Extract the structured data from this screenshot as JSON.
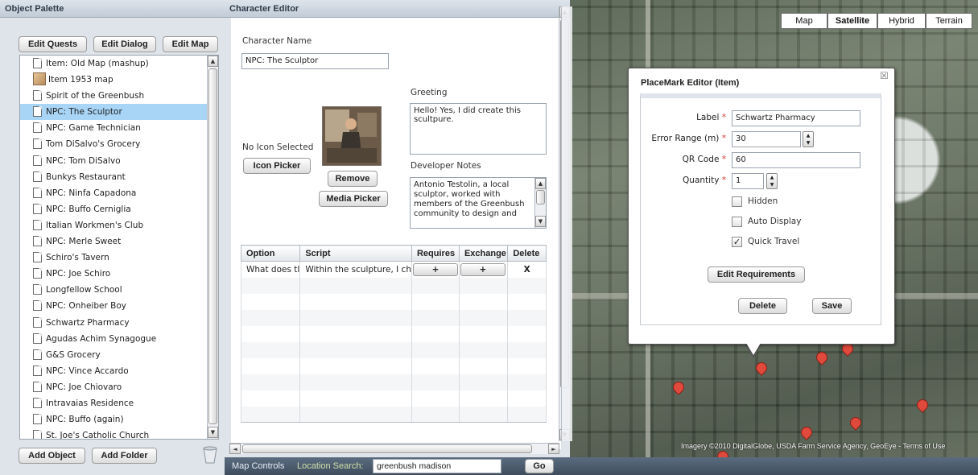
{
  "palette": {
    "title": "Object Palette",
    "buttons": {
      "edit_quests": "Edit Quests",
      "edit_dialog": "Edit Dialog",
      "edit_map": "Edit Map",
      "add_object": "Add Object",
      "add_folder": "Add Folder"
    },
    "items": [
      "Item: Old Map (mashup)",
      "Item 1953 map",
      "Spirit of the Greenbush",
      "NPC: The Sculptor",
      "NPC: Game Technician",
      "Tom DiSalvo's Grocery",
      "NPC: Tom DiSalvo",
      "Bunkys Restaurant",
      "NPC: Ninfa Capadona",
      "NPC: Buffo Cerniglia",
      "Italian Workmen's Club",
      "NPC: Merle Sweet",
      "Schiro's Tavern",
      "NPC: Joe Schiro",
      "Longfellow School",
      "NPC: Onheiber Boy",
      "Schwartz Pharmacy",
      "Agudas Achim Synagogue",
      "G&S Grocery",
      "NPC: Vince Accardo",
      "NPC: Joe Chiovaro",
      "Intravaias Residence",
      "NPC: Buffo (again)",
      "St. Joe's Catholic Church"
    ],
    "selected_index": 3
  },
  "editor": {
    "title": "Character Editor",
    "name_label": "Character Name",
    "name_value": "NPC: The Sculptor",
    "greeting_label": "Greeting",
    "greeting_value": "Hello! Yes, I did create this scultpure.",
    "icon_status": "No Icon Selected",
    "icon_picker": "Icon Picker",
    "remove": "Remove",
    "media_picker": "Media Picker",
    "dev_notes_label": "Developer Notes",
    "dev_notes_value": "Antonio Testolin, a local sculptor, worked with members of the Greenbush community to design and",
    "table": {
      "headers": [
        "Option",
        "Script",
        "Requires",
        "Exchange",
        "Delete"
      ],
      "rows": [
        {
          "option": "What does tl",
          "script": "Within the sculpture, I ch",
          "requires": "+",
          "exchange": "+",
          "delete": "X"
        }
      ]
    }
  },
  "map": {
    "types": [
      "Map",
      "Satellite",
      "Hybrid",
      "Terrain"
    ],
    "active_type": "Satellite",
    "attribution": "Imagery ©2010 DigitalGlobe, USDA Farm Service Agency, GeoEye - Terms of Use"
  },
  "placemark": {
    "title": "PlaceMark Editor (Item)",
    "close": "☒",
    "label_label": "Label",
    "label_value": "Schwartz Pharmacy",
    "error_label": "Error Range (m)",
    "error_value": "30",
    "qr_label": "QR Code",
    "qr_value": "60",
    "quantity_label": "Quantity",
    "quantity_value": "1",
    "required_mark": "*",
    "checkboxes": [
      {
        "label": "Hidden",
        "checked": false
      },
      {
        "label": "Auto Display",
        "checked": false
      },
      {
        "label": "Quick Travel",
        "checked": true
      }
    ],
    "check_mark": "✓",
    "edit_requirements": "Edit Requirements",
    "delete": "Delete",
    "save": "Save"
  },
  "bottom": {
    "map_controls": "Map Controls",
    "location_label": "Location Search:",
    "location_value": "greenbush madison",
    "go": "Go"
  },
  "scroll": {
    "up": "▲",
    "down": "▼",
    "left": "◄",
    "right": "►"
  },
  "colors": {
    "selection": "#a8d4f5",
    "required": "#dd3333",
    "header": "#c2ccd7",
    "bottom_bar": "#4a5a6c"
  }
}
